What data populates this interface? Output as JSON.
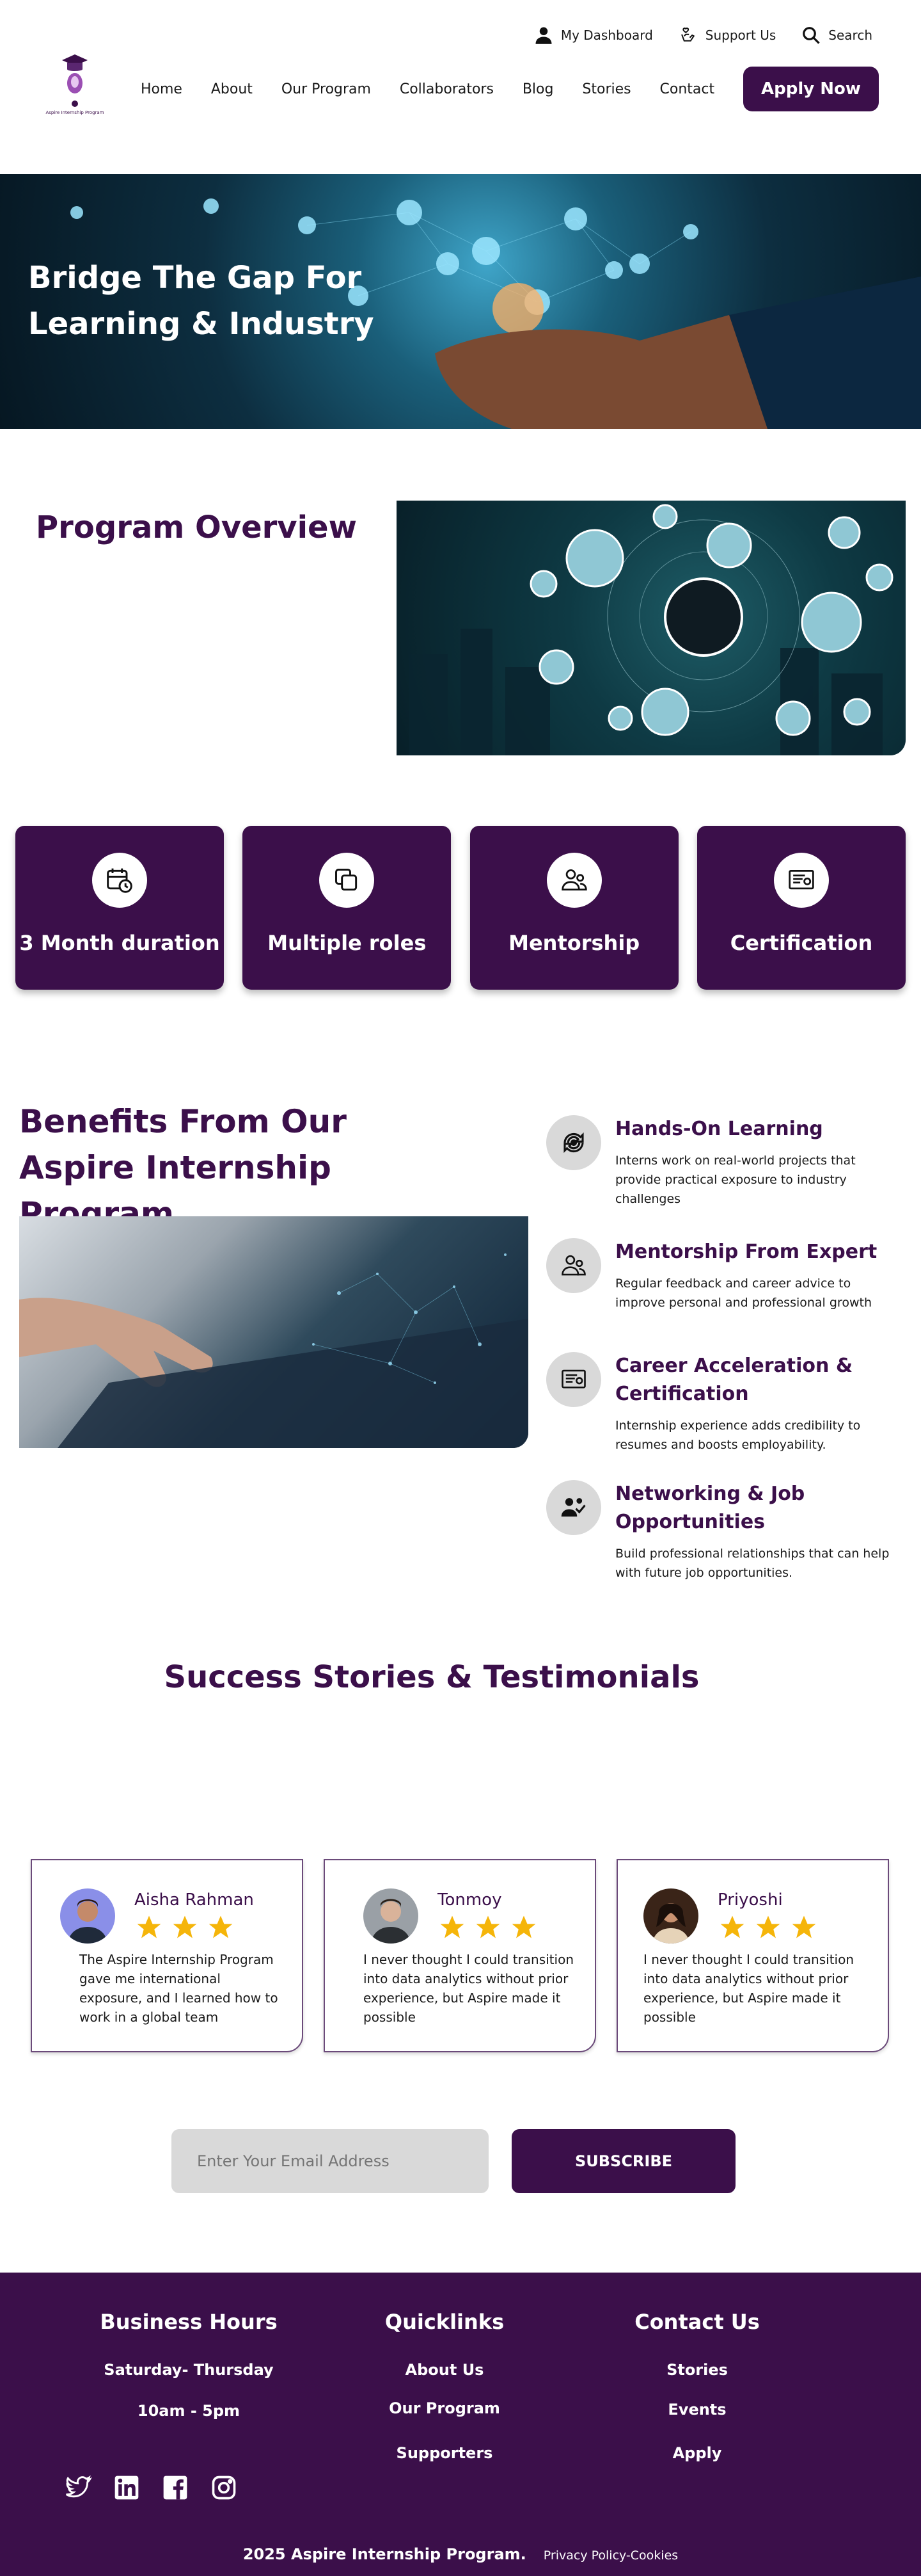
{
  "utility": {
    "dashboard": "My Dashboard",
    "support": "Support Us",
    "search": "Search"
  },
  "logo": {
    "text": "Aspire Internship Program"
  },
  "nav": {
    "items": [
      "Home",
      "About",
      "Our Program",
      "Collaborators",
      "Blog",
      "Stories",
      "Contact"
    ],
    "apply": "Apply Now"
  },
  "hero": {
    "title": "Bridge The Gap For Learning & Industry"
  },
  "overview": {
    "title": "Program Overview"
  },
  "features": [
    {
      "label": "3 Month duration",
      "icon": "calendar-clock-icon"
    },
    {
      "label": "Multiple roles",
      "icon": "copy-stack-icon"
    },
    {
      "label": "Mentorship",
      "icon": "mentor-users-icon"
    },
    {
      "label": "Certification",
      "icon": "certificate-icon"
    }
  ],
  "benefits": {
    "title": "Benefits From Our Aspire Internship Program",
    "items": [
      {
        "title": "Hands-On Learning",
        "desc": "Interns work on real-world projects that provide practical exposure to industry challenges",
        "icon": "cycle-icon"
      },
      {
        "title": "Mentorship From Expert",
        "desc": "Regular feedback and career advice to improve personal and professional growth",
        "icon": "mentor-users-icon"
      },
      {
        "title": "Career Acceleration & Certification",
        "desc": " Internship experience adds credibility to resumes and boosts employability.",
        "icon": "certificate-icon"
      },
      {
        "title": "Networking & Job Opportunities",
        "desc": " Build professional relationships that can help with future job opportunities.",
        "icon": "network-users-icon"
      }
    ]
  },
  "testimonials": {
    "title": "Success Stories & Testimonials",
    "items": [
      {
        "name": "Aisha Rahman",
        "rating": 3,
        "text": "The Aspire Internship Program gave me international exposure, and I learned how to work in a global team"
      },
      {
        "name": "Tonmoy",
        "rating": 3,
        "text": "I never thought I could transition into data analytics without prior experience, but Aspire made it possible"
      },
      {
        "name": "Priyoshi",
        "rating": 3,
        "text": "I never thought I could transition into data analytics without prior experience, but Aspire made it possible"
      }
    ]
  },
  "subscribe": {
    "placeholder": "Enter Your Email Address",
    "button": "SUBSCRIBE"
  },
  "footer": {
    "hours": {
      "title": "Business Hours",
      "days": "Saturday- Thursday",
      "time": "10am - 5pm"
    },
    "quicklinks": {
      "title": "Quicklinks",
      "items": [
        "About Us",
        "Our Program",
        "Supporters"
      ]
    },
    "contact": {
      "title": "Contact Us",
      "items": [
        "Stories",
        "Events",
        "Apply"
      ]
    },
    "socials": [
      "twitter-icon",
      "linkedin-icon",
      "facebook-icon",
      "instagram-icon"
    ],
    "copyright": "2025 Aspire Internship Program.",
    "links": "Privacy Policy-Cookies"
  },
  "colors": {
    "brand": "#3b0f4a",
    "star": "#f5b50a",
    "field": "#d9d9d9"
  }
}
